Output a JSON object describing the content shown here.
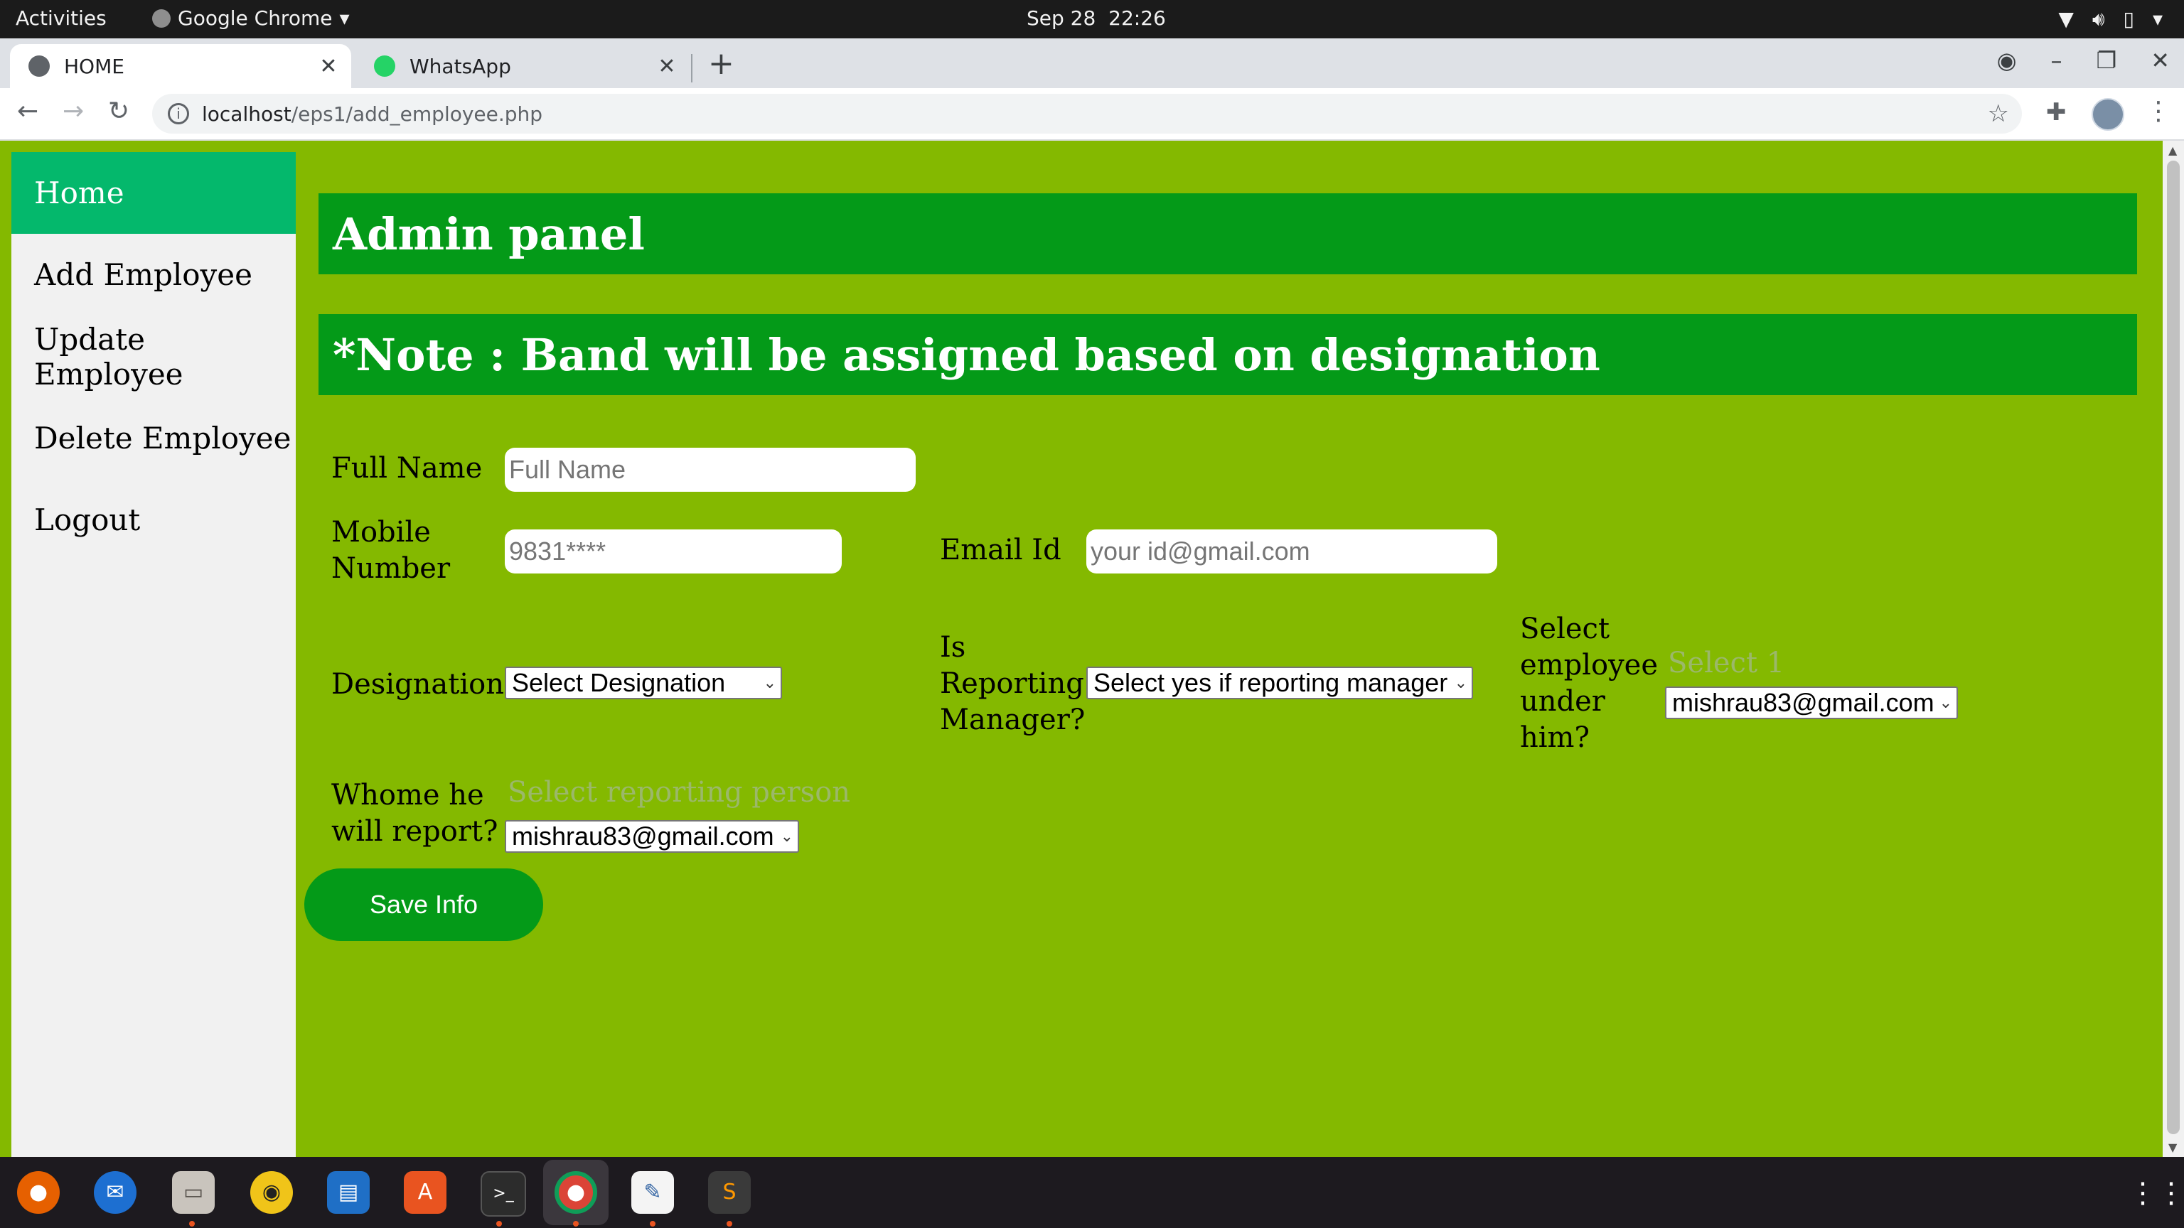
{
  "system_bar": {
    "activities": "Activities",
    "app_name": "Google Chrome",
    "date": "Sep 28",
    "time": "22:26"
  },
  "tabs": [
    {
      "title": "HOME",
      "active": true
    },
    {
      "title": "WhatsApp",
      "active": false
    }
  ],
  "address_bar": {
    "host": "localhost",
    "path": "/eps1/add_employee.php"
  },
  "sidebar": {
    "items": [
      {
        "label": "Home",
        "active": true
      },
      {
        "label": "Add Employee",
        "active": false
      },
      {
        "label": "Update Employee",
        "active": false
      },
      {
        "label": "Delete Employee",
        "active": false
      },
      {
        "label": "Logout",
        "active": false
      }
    ]
  },
  "page": {
    "title": "Admin panel",
    "note": "*Note : Band will be assigned based on designation"
  },
  "form": {
    "full_name": {
      "label": "Full Name",
      "placeholder": "Full Name",
      "value": ""
    },
    "mobile": {
      "label_line1": "Mobile",
      "label_line2": "Number",
      "placeholder": "9831****",
      "value": ""
    },
    "email": {
      "label": "Email Id",
      "placeholder": "your id@gmail.com",
      "value": ""
    },
    "designation": {
      "label": "Designation",
      "selected": "Select Designation"
    },
    "is_manager": {
      "label_line1": "Is",
      "label_line2": "Reporting",
      "label_line3": "Manager?",
      "selected": "Select yes if reporting manager"
    },
    "employees_under": {
      "label_line1": "Select",
      "label_line2": "employee",
      "label_line3": "under",
      "label_line4": "him?",
      "hint": "Select 1",
      "selected": "mishrau83@gmail.com"
    },
    "reports_to": {
      "label_line1": "Whome he",
      "label_line2": "will report?",
      "hint": "Select reporting person",
      "selected": "mishrau83@gmail.com"
    },
    "save_label": "Save Info"
  },
  "colors": {
    "page_background": "#84b900",
    "banner": "#049a18",
    "sidebar_active": "#04b86c",
    "save_button": "#049a18"
  },
  "dock": {
    "apps": [
      "firefox-icon",
      "thunderbird-icon",
      "files-icon",
      "rhythmbox-icon",
      "writer-icon",
      "software-icon",
      "terminal-icon",
      "chrome-icon",
      "text-editor-icon",
      "sublime-icon"
    ]
  }
}
